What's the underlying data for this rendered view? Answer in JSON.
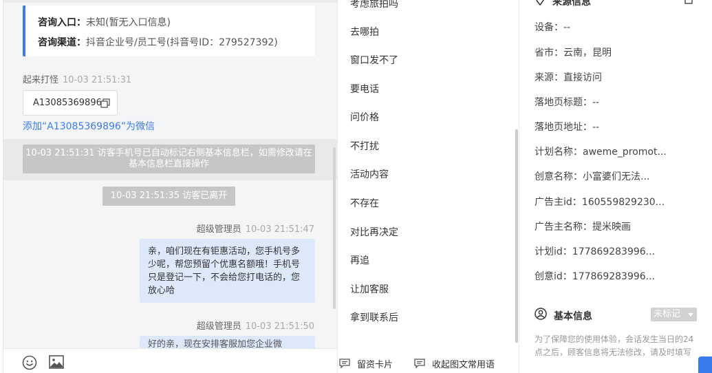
{
  "chat": {
    "entry": {
      "entrance_label": "咨询入口：",
      "entrance_value": "未知(暂无入口信息)",
      "channel_label": "咨询渠道：",
      "channel_value": "抖音企业号/员工号(抖音号ID：279527392)"
    },
    "system_message": {
      "sender": "起来打怪",
      "time": "10-03 21:51:31",
      "id_value": "A13085369896",
      "add_wechat_link": "添加“A13085369896”为微信"
    },
    "auto_note": "10-03 21:51:31 访客手机号已自动标记右侧基本信息栏，如需修改请在基本信息栏直接操作",
    "left_note": "10-03 21:51:35 访客已离开",
    "agent_messages": [
      {
        "sender": "超级管理员",
        "time": "10-03 21:51:47",
        "text": "亲，咱们现在有钜惠活动，您手机号多少呢，帮您预留个优惠名额哦！手机号只是登记一下，不会给您打电话的，您放心哈"
      },
      {
        "sender": "超级管理员",
        "time": "10-03 21:51:50",
        "text": "好的亲，现在安排客服加您企业微"
      }
    ]
  },
  "phrases": {
    "items": [
      "考虑旅拍吗",
      "去哪拍",
      "窗口发不了",
      "要电话",
      "问价格",
      "不打扰",
      "活动内容",
      "不存在",
      "对比再决定",
      "再追",
      "让加客服",
      "拿到联系后"
    ],
    "actions": {
      "card_label": "留资卡片",
      "collapse_label": "收起图文常用语"
    }
  },
  "info": {
    "source_title": "来源信息",
    "rows": [
      {
        "label": "设备：",
        "value": "--"
      },
      {
        "label": "省市：",
        "value": "云南，昆明"
      },
      {
        "label": "来源：",
        "value": "直接访问"
      },
      {
        "label": "落地页标题：",
        "value": "--"
      },
      {
        "label": "落地页地址：",
        "value": "--"
      },
      {
        "label": "计划名称：",
        "value": "aweme_promot..."
      },
      {
        "label": "创意名称：",
        "value": "小富婆们无法..."
      },
      {
        "label": "广告主id：",
        "value": "160559829230..."
      },
      {
        "label": "广告主名称：",
        "value": "提米映画"
      },
      {
        "label": "计划id：",
        "value": "177869283996..."
      },
      {
        "label": "创意id：",
        "value": "177869283996..."
      }
    ],
    "basic_title": "基本信息",
    "mark_select": "未标记",
    "basic_hint": "为了保障您的使用体验，会话发生当日的24点之后，顾客信息将无法修改，请及时填写"
  },
  "colors": {
    "accent": "#3a7bf0",
    "agent_bubble": "#dde8fb",
    "system_note": "#c5c6c8"
  }
}
